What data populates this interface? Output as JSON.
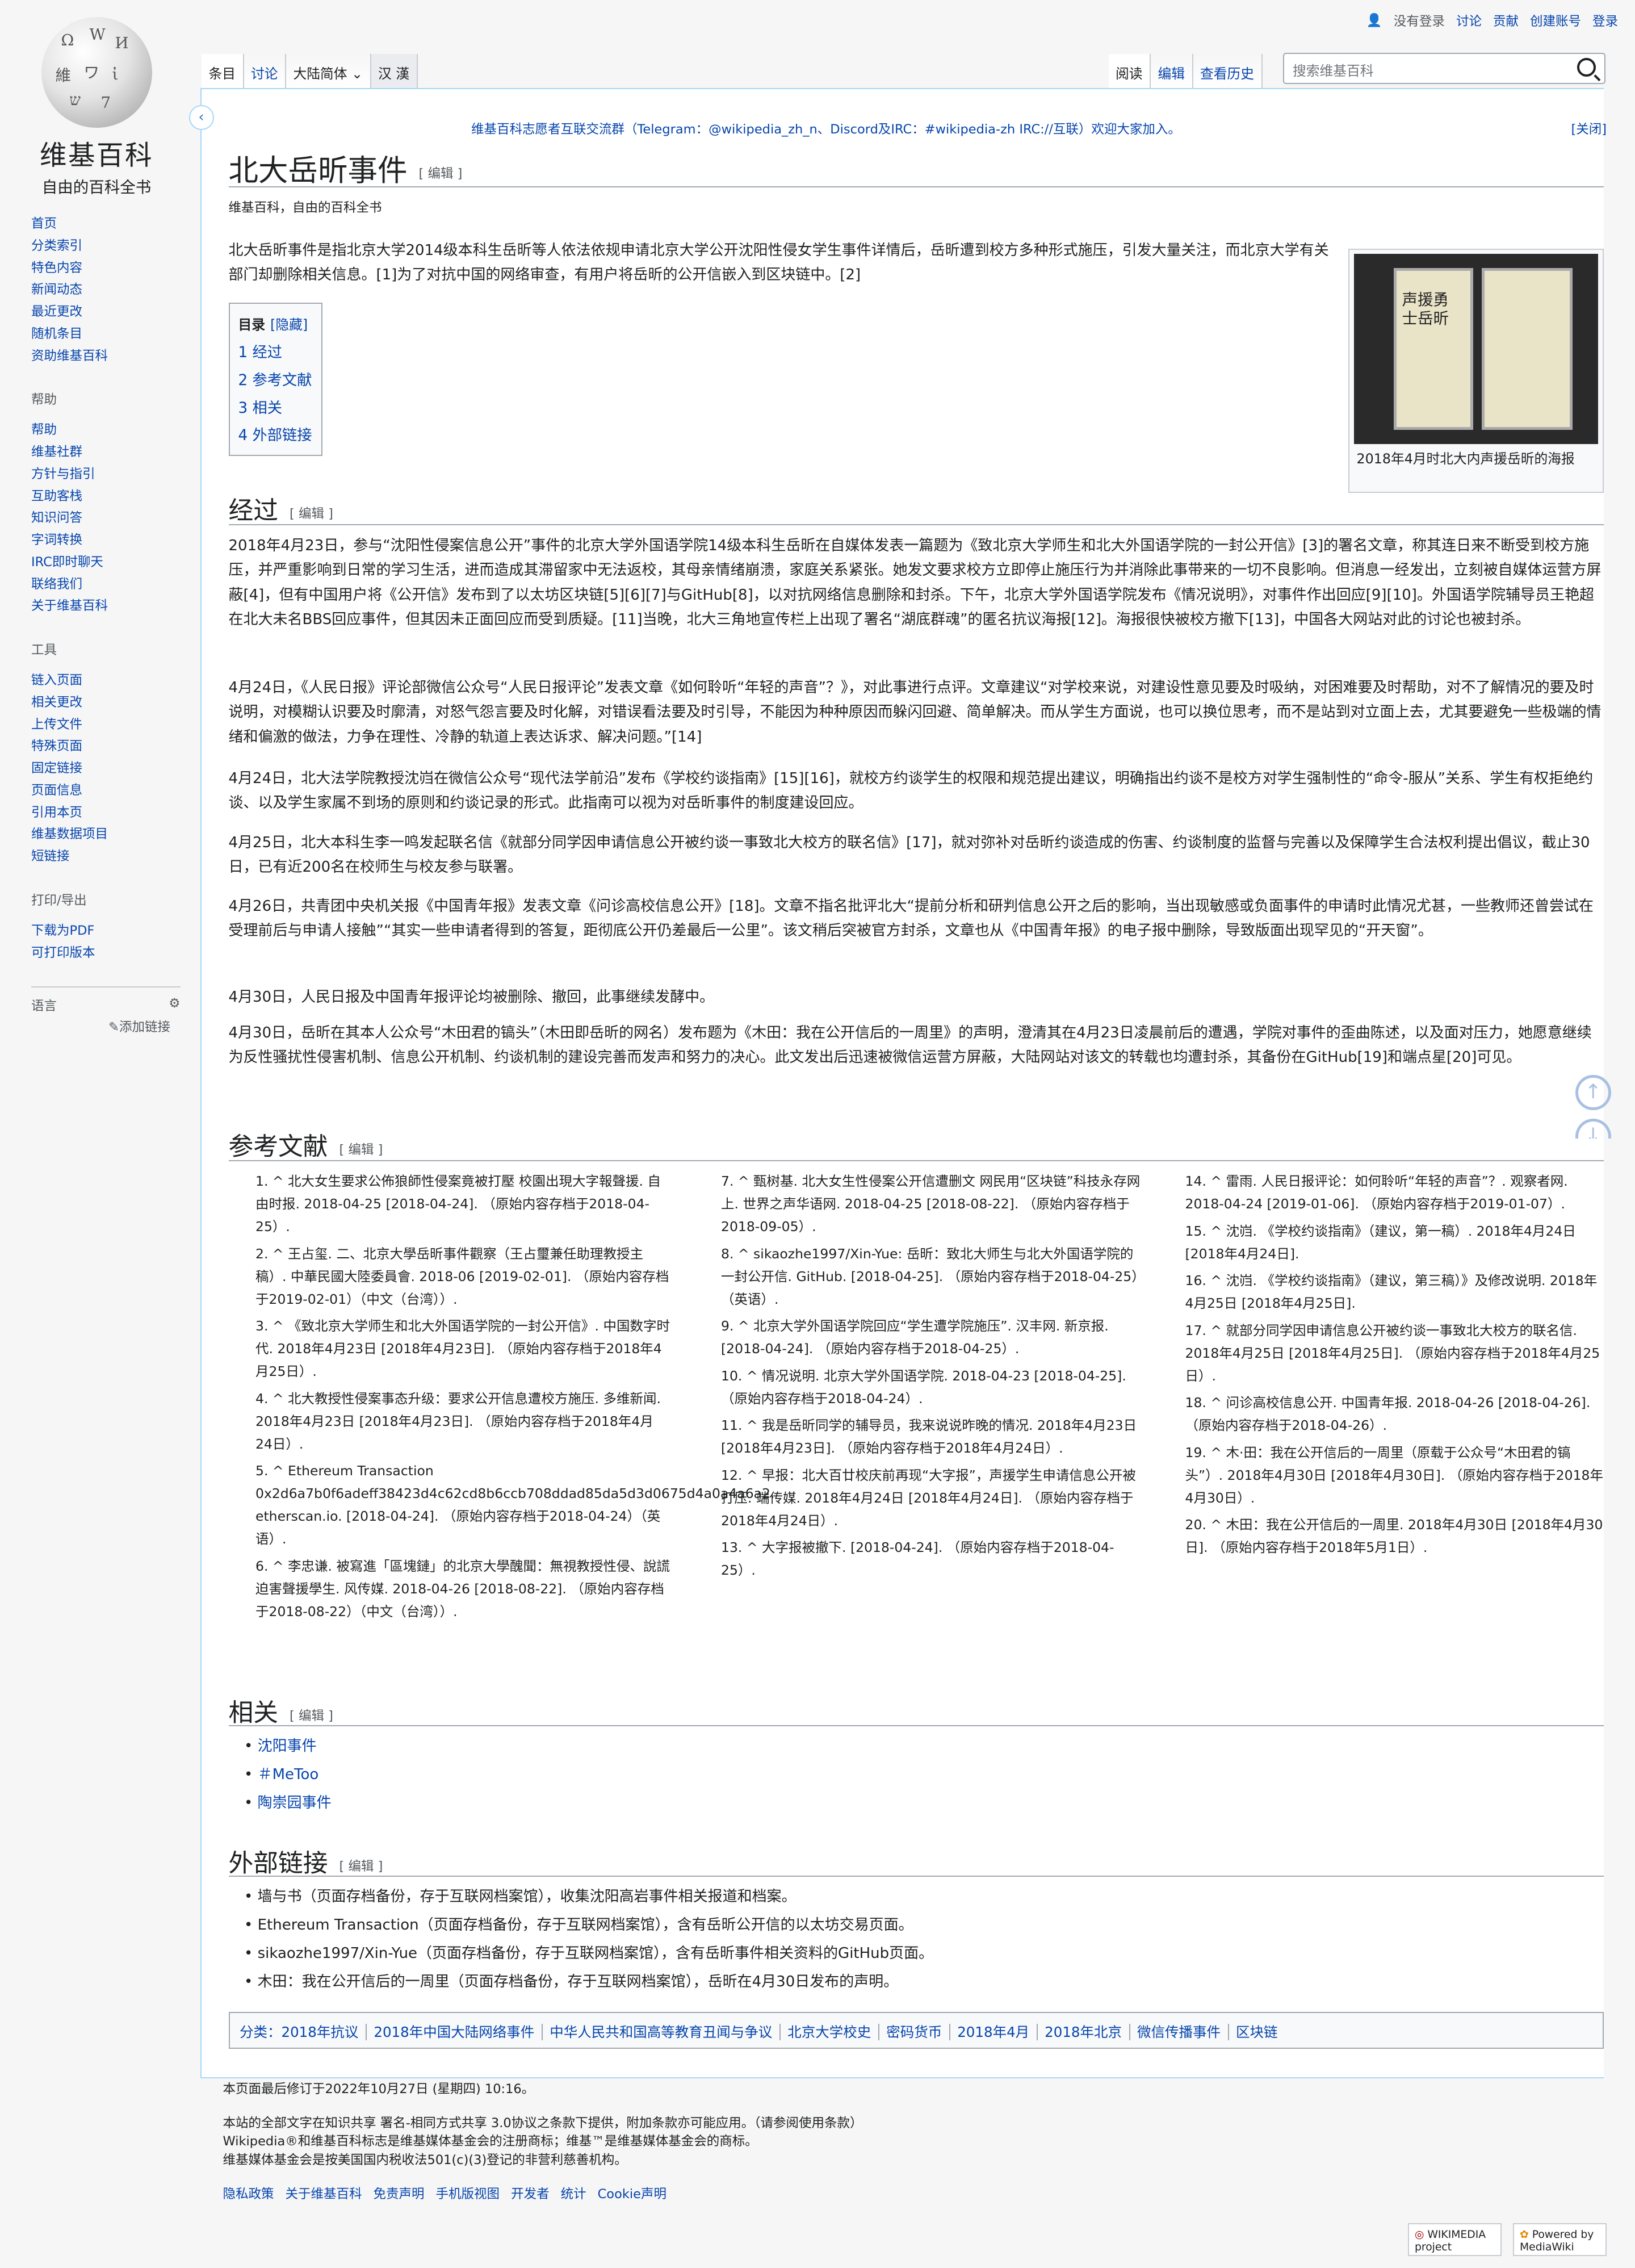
{
  "site": {
    "name": "维基百科",
    "tagline": "自由的百科全书"
  },
  "personal": {
    "not_logged": "没有登录",
    "talk": "讨论",
    "contrib": "贡献",
    "create": "创建账号",
    "login": "登录"
  },
  "tabs_left": [
    "条目",
    "讨论",
    "大陆简体",
    "汉 漢"
  ],
  "tabs_right": [
    "阅读",
    "编辑",
    "查看历史"
  ],
  "search": {
    "placeholder": "搜索维基百科"
  },
  "notice": {
    "text": "维基百科志愿者互联交流群（Telegram：@wikipedia_zh_n、Discord及IRC：#wikipedia-zh IRC://互联）欢迎大家加入。",
    "close": "[关闭]"
  },
  "nav": {
    "main": [
      "首页",
      "分类索引",
      "特色内容",
      "新闻动态",
      "最近更改",
      "随机条目",
      "资助维基百科"
    ],
    "help_h": "帮助",
    "help": [
      "帮助",
      "维基社群",
      "方针与指引",
      "互助客栈",
      "知识问答",
      "字词转换",
      "IRC即时聊天",
      "联络我们",
      "关于维基百科"
    ],
    "tools_h": "工具",
    "tools": [
      "链入页面",
      "相关更改",
      "上传文件",
      "特殊页面",
      "固定链接",
      "页面信息",
      "引用本页",
      "维基数据项目",
      "短链接"
    ],
    "print_h": "打印/导出",
    "print": [
      "下载为PDF",
      "可打印版本"
    ],
    "lang_h": "语言",
    "addlink": "添加链接"
  },
  "article": {
    "title": "北大岳昕事件",
    "edit": "[ 编辑 ]",
    "from": "维基百科，自由的百科全书",
    "lead": "北大岳昕事件是指北京大学2014级本科生岳昕等人依法依规申请北京大学公开沈阳性侵女学生事件详情后，岳昕遭到校方多种形式施压，引发大量关注，而北京大学有关部门却删除相关信息。[1]为了对抗中国的网络审查，有用户将岳昕的公开信嵌入到区块链中。[2]",
    "toc": {
      "title": "目录",
      "hide": "[隐藏]",
      "items": [
        "1 经过",
        "2 参考文献",
        "3 相关",
        "4 外部链接"
      ]
    },
    "image_caption": "2018年4月时北大内声援岳昕的海报",
    "poster_text": "声援勇士岳昕",
    "h_course": "经过",
    "paras": [
      "2018年4月23日，参与“沈阳性侵案信息公开”事件的北京大学外国语学院14级本科生岳昕在自媒体发表一篇题为《致北京大学师生和北大外国语学院的一封公开信》[3]的署名文章，称其连日来不断受到校方施压，并严重影响到日常的学习生活，进而造成其滞留家中无法返校，其母亲情绪崩溃，家庭关系紧张。她发文要求校方立即停止施压行为并消除此事带来的一切不良影响。但消息一经发出，立刻被自媒体运营方屏蔽[4]，但有中国用户将《公开信》发布到了以太坊区块链[5][6][7]与GitHub[8]，以对抗网络信息删除和封杀。下午，北京大学外国语学院发布《情况说明》，对事件作出回应[9][10]。外国语学院辅导员王艳超在北大未名BBS回应事件，但其因未正面回应而受到质疑。[11]当晚，北大三角地宣传栏上出现了署名“湖底群魂”的匿名抗议海报[12]。海报很快被校方撤下[13]，中国各大网站对此的讨论也被封杀。",
      "4月24日，《人民日报》评论部微信公众号“人民日报评论”发表文章《如何聆听“年轻的声音”？》，对此事进行点评。文章建议“对学校来说，对建设性意见要及时吸纳，对困难要及时帮助，对不了解情况的要及时说明，对模糊认识要及时廓清，对怒气怨言要及时化解，对错误看法要及时引导，不能因为种种原因而躲闪回避、简单解决。而从学生方面说，也可以换位思考，而不是站到对立面上去，尤其要避免一些极端的情绪和偏激的做法，力争在理性、冷静的轨道上表达诉求、解决问题。”[14]",
      "4月24日，北大法学院教授沈岿在微信公众号“现代法学前沿”发布《学校约谈指南》[15][16]，就校方约谈学生的权限和规范提出建议，明确指出约谈不是校方对学生强制性的“命令-服从”关系、学生有权拒绝约谈、以及学生家属不到场的原则和约谈记录的形式。此指南可以视为对岳昕事件的制度建设回应。",
      "4月25日，北大本科生李一鸣发起联名信《就部分同学因申请信息公开被约谈一事致北大校方的联名信》[17]，就对弥补对岳昕约谈造成的伤害、约谈制度的监督与完善以及保障学生合法权利提出倡议，截止30日，已有近200名在校师生与校友参与联署。",
      "4月26日，共青团中央机关报《中国青年报》发表文章《问诊高校信息公开》[18]。文章不指名批评北大“提前分析和研判信息公开之后的影响，当出现敏感或负面事件的申请时此情况尤甚，一些教师还曾尝试在受理前后与申请人接触”“其实一些申请者得到的答复，距彻底公开仍差最后一公里”。该文稍后突被官方封杀，文章也从《中国青年报》的电子报中删除，导致版面出现罕见的“开天窗”。",
      "4月30日，人民日报及中国青年报评论均被删除、撤回，此事继续发酵中。",
      "4月30日，岳昕在其本人公众号“木田君的镐头”（木田即岳昕的网名）发布题为《木田：我在公开信后的一周里》的声明，澄清其在4月23日凌晨前后的遭遇，学院对事件的歪曲陈述，以及面对压力，她愿意继续为反性骚扰性侵害机制、信息公开机制、约谈机制的建设完善而发声和努力的决心。此文发出后迅速被微信运营方屏蔽，大陆网站对该文的转载也均遭封杀，其备份在GitHub[19]和端点星[20]可见。"
    ],
    "h_refs": "参考文献",
    "refs_col1": [
      "1. ^ 北大女生要求公佈狼師性侵案竟被打壓 校園出現大字報聲援. 自由时报. 2018-04-25 [2018-04-24]. （原始内容存档于2018-04-25）.",
      "2. ^ 王占玺. 二、北京大學岳昕事件觀察（王占璽兼任助理教授主稿）. 中華民國大陸委員會. 2018-06 [2019-02-01]. （原始内容存档于2019-02-01）（中文（台湾））.",
      "3. ^ 《致北京大学师生和北大外国语学院的一封公开信》. 中国数字时代. 2018年4月23日 [2018年4月23日]. （原始内容存档于2018年4月25日）.",
      "4. ^ 北大教授性侵案事态升级：要求公开信息遭校方施压. 多维新闻. 2018年4月23日 [2018年4月23日]. （原始内容存档于2018年4月24日）.",
      "5. ^ Ethereum Transaction 0x2d6a7b0f6adeff38423d4c62cd8b6ccb708ddad85da5d3d0675d4a0a4a6a2. etherscan.io. [2018-04-24]. （原始内容存档于2018-04-24）（英语）.",
      "6. ^ 李忠谦. 被寫進「區塊鏈」的北京大學醜聞：無視教授性侵、說謊迫害聲援學生. 风传媒. 2018-04-26 [2018-08-22]. （原始内容存档于2018-08-22）（中文（台湾））."
    ],
    "refs_col2": [
      "7. ^ 甄树基. 北大女生性侵案公开信遭删文 网民用“区块链”科技永存网上. 世界之声华语网. 2018-04-25 [2018-08-22]. （原始内容存档于2018-09-05）.",
      "8. ^ sikaozhe1997/Xin-Yue: 岳昕：致北大师生与北大外国语学院的一封公开信. GitHub. [2018-04-25]. （原始内容存档于2018-04-25）（英语）.",
      "9. ^ 北京大学外国语学院回应“学生遭学院施压”. 汉丰网. 新京报. [2018-04-24]. （原始内容存档于2018-04-25）.",
      "10. ^ 情况说明. 北京大学外国语学院. 2018-04-23 [2018-04-25]. （原始内容存档于2018-04-24）.",
      "11. ^ 我是岳昕同学的辅导员，我来说说昨晚的情况. 2018年4月23日 [2018年4月23日]. （原始内容存档于2018年4月24日）.",
      "12. ^ 早报：北大百廿校庆前再现“大字报”，声援学生申请信息公开被打压. 端传媒. 2018年4月24日 [2018年4月24日]. （原始内容存档于2018年4月24日）.",
      "13. ^ 大字报被撤下. [2018-04-24]. （原始内容存档于2018-04-25）."
    ],
    "refs_col3": [
      "14. ^ 雷雨. 人民日报评论：如何聆听“年轻的声音”？. 观察者网. 2018-04-24 [2019-01-06]. （原始内容存档于2019-01-07）.",
      "15. ^ 沈岿. 《学校约谈指南》（建议，第一稿）. 2018年4月24日 [2018年4月24日].",
      "16. ^ 沈岿. 《学校约谈指南》（建议，第三稿）》及修改说明. 2018年4月25日 [2018年4月25日].",
      "17. ^ 就部分同学因申请信息公开被约谈一事致北大校方的联名信. 2018年4月25日 [2018年4月25日]. （原始内容存档于2018年4月25日）.",
      "18. ^ 问诊高校信息公开. 中国青年报. 2018-04-26 [2018-04-26]. （原始内容存档于2018-04-26）.",
      "19. ^ 木·田：我在公开信后的一周里（原载于公众号“木田君的镐头”）. 2018年4月30日 [2018年4月30日]. （原始内容存档于2018年4月30日）.",
      "20. ^ 木田：我在公开信后的一周里. 2018年4月30日 [2018年4月30日]. （原始内容存档于2018年5月1日）."
    ],
    "h_related": "相关",
    "related": [
      "沈阳事件",
      "＃MeToo",
      "陶崇园事件"
    ],
    "h_ext": "外部链接",
    "ext": [
      "墙与书（页面存档备份，存于互联网档案馆），收集沈阳高岩事件相关报道和档案。",
      "Ethereum Transaction（页面存档备份，存于互联网档案馆），含有岳昕公开信的以太坊交易页面。",
      "sikaozhe1997/Xin-Yue（页面存档备份，存于互联网档案馆），含有岳昕事件相关资料的GitHub页面。",
      "木田：我在公开信后的一周里（页面存档备份，存于互联网档案馆），岳昕在4月30日发布的声明。"
    ],
    "cats_label": "分类：",
    "cats": [
      "2018年抗议",
      "2018年中国大陆网络事件",
      "中华人民共和国高等教育丑闻与争议",
      "北京大学校史",
      "密码货币",
      "2018年4月",
      "2018年北京",
      "微信传播事件",
      "区块链"
    ]
  },
  "footer": {
    "modified": "本页面最后修订于2022年10月27日 (星期四) 10:16。",
    "license1": "本站的全部文字在知识共享 署名-相同方式共享 3.0协议之条款下提供，附加条款亦可能应用。（请参阅使用条款）",
    "license2": "Wikipedia®和维基百科标志是维基媒体基金会的注册商标；维基™是维基媒体基金会的商标。",
    "license3": "维基媒体基金会是按美国国内税收法501(c)(3)登记的非营利慈善机构。",
    "links": [
      "隐私政策",
      "关于维基百科",
      "免责声明",
      "手机版视图",
      "开发者",
      "统计",
      "Cookie声明"
    ],
    "badge1": "WIKIMEDIA project",
    "badge2": "Powered by MediaWiki"
  }
}
